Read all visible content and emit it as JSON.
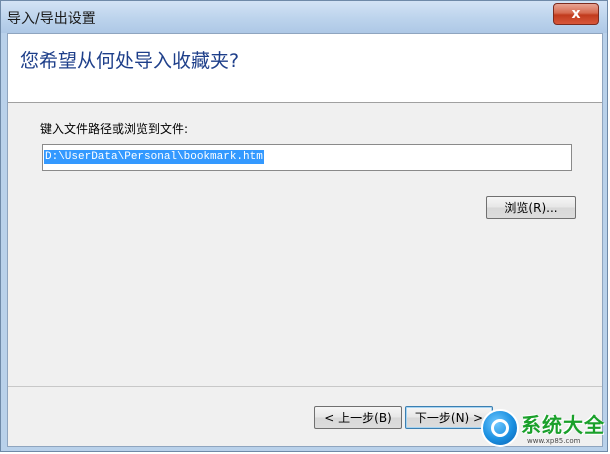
{
  "window": {
    "title": "导入/导出设置",
    "close_label": "x"
  },
  "header": {
    "heading": "您希望从何处导入收藏夹?"
  },
  "form": {
    "path_label": "键入文件路径或浏览到文件:",
    "path_value": "D:\\UserData\\Personal\\bookmark.htm",
    "browse_label": "浏览(R)..."
  },
  "footer": {
    "back_label": "< 上一步(B)",
    "next_label": "下一步(N) >"
  },
  "watermark": {
    "brand": "系统大全",
    "url": "www.xp85.com"
  },
  "colors": {
    "title_bar": "#bcd3ec",
    "heading": "#1e3f8a",
    "selection": "#3399ff",
    "close_button": "#c13b1e",
    "watermark_green": "#1aa02a"
  }
}
